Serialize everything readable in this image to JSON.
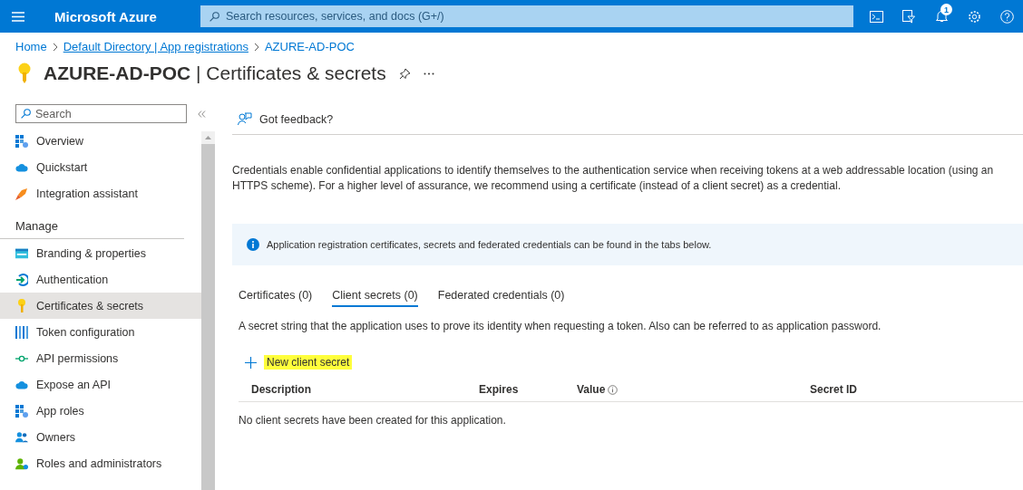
{
  "topbar": {
    "brand": "Microsoft Azure",
    "search": {
      "placeholder": "Search resources, services, and docs (G+/)"
    },
    "notification_count": "1"
  },
  "breadcrumb": [
    {
      "label": "Home",
      "underlined": false
    },
    {
      "label": "Default Directory | App registrations",
      "underlined": true
    },
    {
      "label": "AZURE-AD-POC",
      "underlined": false
    }
  ],
  "page": {
    "title": "**AZURE-AD-POC** | Certificates & secrets"
  },
  "sidebar": {
    "search": {
      "placeholder": "Search"
    },
    "items": [
      {
        "label": "Overview",
        "kind": "grid",
        "selected": false
      },
      {
        "label": "Quickstart",
        "kind": "cloud",
        "selected": false
      },
      {
        "label": "Integration assistant",
        "kind": "rocket",
        "selected": false
      }
    ],
    "section_heading": "Manage",
    "section_items": [
      {
        "label": "Branding & properties",
        "kind": "card",
        "selected": false
      },
      {
        "label": "Authentication",
        "kind": "auth",
        "selected": false
      },
      {
        "label": "Certificates & secrets",
        "kind": "key",
        "selected": true
      },
      {
        "label": "Token configuration",
        "kind": "bars",
        "selected": false
      },
      {
        "label": "API permissions",
        "kind": "api",
        "selected": false
      },
      {
        "label": "Expose an API",
        "kind": "cloud",
        "selected": false
      },
      {
        "label": "App roles",
        "kind": "grid",
        "selected": false
      },
      {
        "label": "Owners",
        "kind": "people",
        "selected": false
      },
      {
        "label": "Roles and administrators",
        "kind": "person",
        "selected": false
      }
    ]
  },
  "feedback": "Got feedback?",
  "description": "Credentials enable confidential applications to identify themselves to the authentication service when receiving tokens at a web addressable location (using an HTTPS scheme). For a higher level of assurance, we recommend using a certificate (instead of a client secret) as a credential.",
  "info_banner": "Application registration certificates, secrets and federated credentials can be found in the tabs below.",
  "tabs": [
    {
      "label": "Certificates (0)",
      "selected": false
    },
    {
      "label": "Client secrets (0)",
      "selected": true
    },
    {
      "label": "Federated credentials (0)",
      "selected": false
    }
  ],
  "tab_description": "A secret string that the application uses to prove its identity when requesting a token. Also can be referred to as application password.",
  "new_button": {
    "label": "New client secret",
    "highlighted": true
  },
  "table": {
    "columns": [
      {
        "label": "Description",
        "info": false
      },
      {
        "label": "Expires",
        "info": false
      },
      {
        "label": "Value",
        "info": true
      },
      {
        "label": "Secret ID",
        "info": false
      }
    ],
    "empty_message": "No client secrets have been created for this application."
  }
}
